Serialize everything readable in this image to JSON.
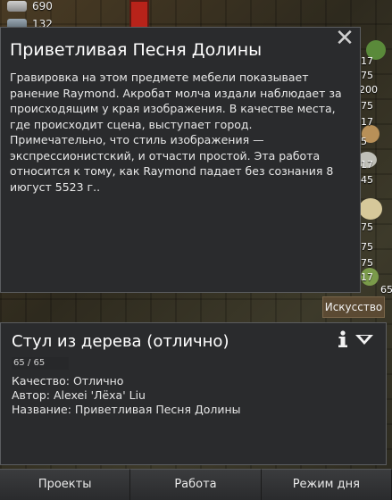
{
  "resources": [
    {
      "icon": "steel-icon",
      "value": "690"
    },
    {
      "icon": "stone-icon",
      "value": "132"
    }
  ],
  "shelf_numbers": [
    "17",
    "75",
    "200",
    "75",
    "17",
    "5",
    "17",
    "45",
    "75",
    "75",
    "75",
    "17",
    "65"
  ],
  "popup": {
    "title": "Приветливая Песня Долины",
    "close_label": "✕",
    "body": "Гравировка на этом предмете мебели показывает ранение Raymond. Акробат молча издали наблюдает за происходящим у края изображения. В качестве места, где происходит сцена, выступает город. Примечательно, что стиль изображения — экспрессионистский, и отчасти простой. Эта работа относится к тому, как Raymond падает без сознания 8 июгуст 5523 г.."
  },
  "art_tab": "Искусство",
  "selection": {
    "title": "Стул из дерева (отлично)",
    "hp_text": "65 / 65",
    "hp_fraction": 1.0,
    "quality": "Качество: Отлично",
    "author": "Автор: Alexei 'Лёха' Liu",
    "name": "Название: Приветливая Песня Долины"
  },
  "bottom_bar": [
    "Проекты",
    "Работа",
    "Режим дня"
  ]
}
